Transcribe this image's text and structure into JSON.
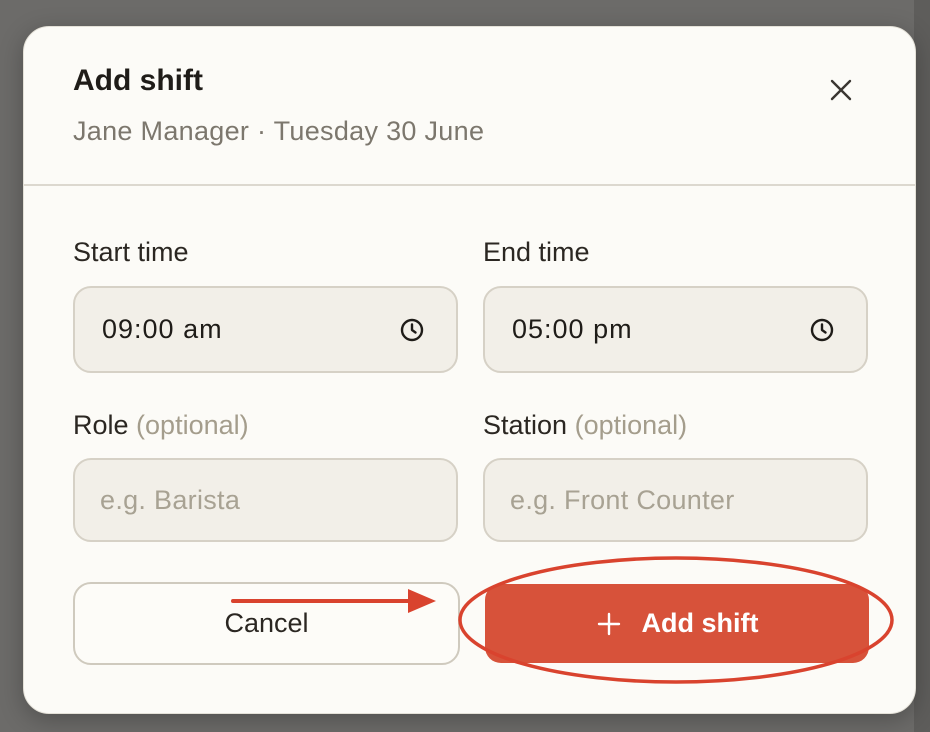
{
  "dialog": {
    "title": "Add shift",
    "subtitle": "Jane Manager · Tuesday 30 June",
    "close_icon": "close-icon"
  },
  "form": {
    "start_time": {
      "label": "Start time",
      "value": "09:00 am",
      "icon": "clock-icon"
    },
    "end_time": {
      "label": "End time",
      "value": "05:00 pm",
      "icon": "clock-icon"
    },
    "role": {
      "label": "Role",
      "optional": "(optional)",
      "placeholder": "e.g. Barista"
    },
    "station": {
      "label": "Station",
      "optional": "(optional)",
      "placeholder": "e.g. Front Counter"
    }
  },
  "actions": {
    "cancel_label": "Cancel",
    "add_label": "Add shift",
    "add_icon": "plus-icon"
  },
  "colors": {
    "accent": "#d7523a",
    "annotation": "#d9432e",
    "surface": "#fcfbf7",
    "field_bg": "#f2efe8"
  },
  "annotation": {
    "arrow": "arrow pointing to Add shift",
    "highlight": "ellipse around Add shift button"
  }
}
